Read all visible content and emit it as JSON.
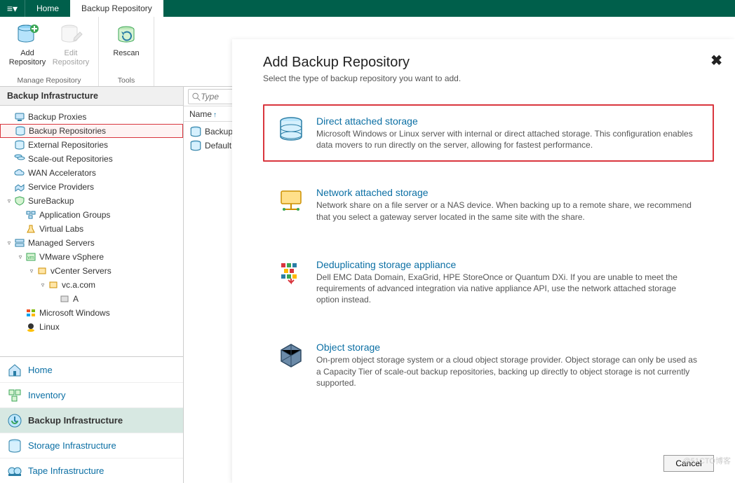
{
  "menubar": {
    "home": "Home",
    "active_tab": "Backup Repository"
  },
  "ribbon": {
    "manage": {
      "label": "Manage Repository",
      "add": "Add\nRepository",
      "edit": "Edit\nRepository"
    },
    "tools": {
      "label": "Tools",
      "rescan": "Rescan"
    }
  },
  "sidebar": {
    "header": "Backup Infrastructure",
    "items": [
      {
        "label": "Backup Proxies"
      },
      {
        "label": "Backup Repositories"
      },
      {
        "label": "External Repositories"
      },
      {
        "label": "Scale-out Repositories"
      },
      {
        "label": "WAN Accelerators"
      },
      {
        "label": "Service Providers"
      }
    ],
    "surebackup": {
      "label": "SureBackup",
      "children": [
        "Application Groups",
        "Virtual Labs"
      ]
    },
    "managed": {
      "label": "Managed Servers",
      "vmware": "VMware vSphere",
      "vcenter": "vCenter Servers",
      "host": "vc.a.com",
      "node": "A",
      "mswin": "Microsoft Windows",
      "linux": "Linux"
    }
  },
  "bottomnav": {
    "items": [
      {
        "label": "Home"
      },
      {
        "label": "Inventory"
      },
      {
        "label": "Backup Infrastructure"
      },
      {
        "label": "Storage Infrastructure"
      },
      {
        "label": "Tape Infrastructure"
      }
    ]
  },
  "content": {
    "search_placeholder": "Type",
    "col_name": "Name",
    "rows": [
      {
        "label": "Backup"
      },
      {
        "label": "Default"
      }
    ]
  },
  "dialog": {
    "title": "Add Backup Repository",
    "subtitle": "Select the type of backup repository you want to add.",
    "close": "✖",
    "options": [
      {
        "title": "Direct attached storage",
        "desc": "Microsoft Windows or Linux server with internal or direct attached storage. This configuration enables data movers to run directly on the server, allowing for fastest performance."
      },
      {
        "title": "Network attached storage",
        "desc": "Network share on a file server or a NAS device. When backing up to a remote share, we recommend that you select a gateway server located in the same site with the share."
      },
      {
        "title": "Deduplicating storage appliance",
        "desc": "Dell EMC Data Domain, ExaGrid, HPE StoreOnce or Quantum DXi. If you are unable to meet the requirements of advanced integration via native appliance API, use the network attached storage option instead."
      },
      {
        "title": "Object storage",
        "desc": "On-prem object storage system or a cloud object storage provider. Object storage can only be used as a Capacity Tier of scale-out backup repositories, backing up directly to object storage is not currently supported."
      }
    ],
    "cancel": "Cancel"
  },
  "watermark": "@51CTO博客"
}
